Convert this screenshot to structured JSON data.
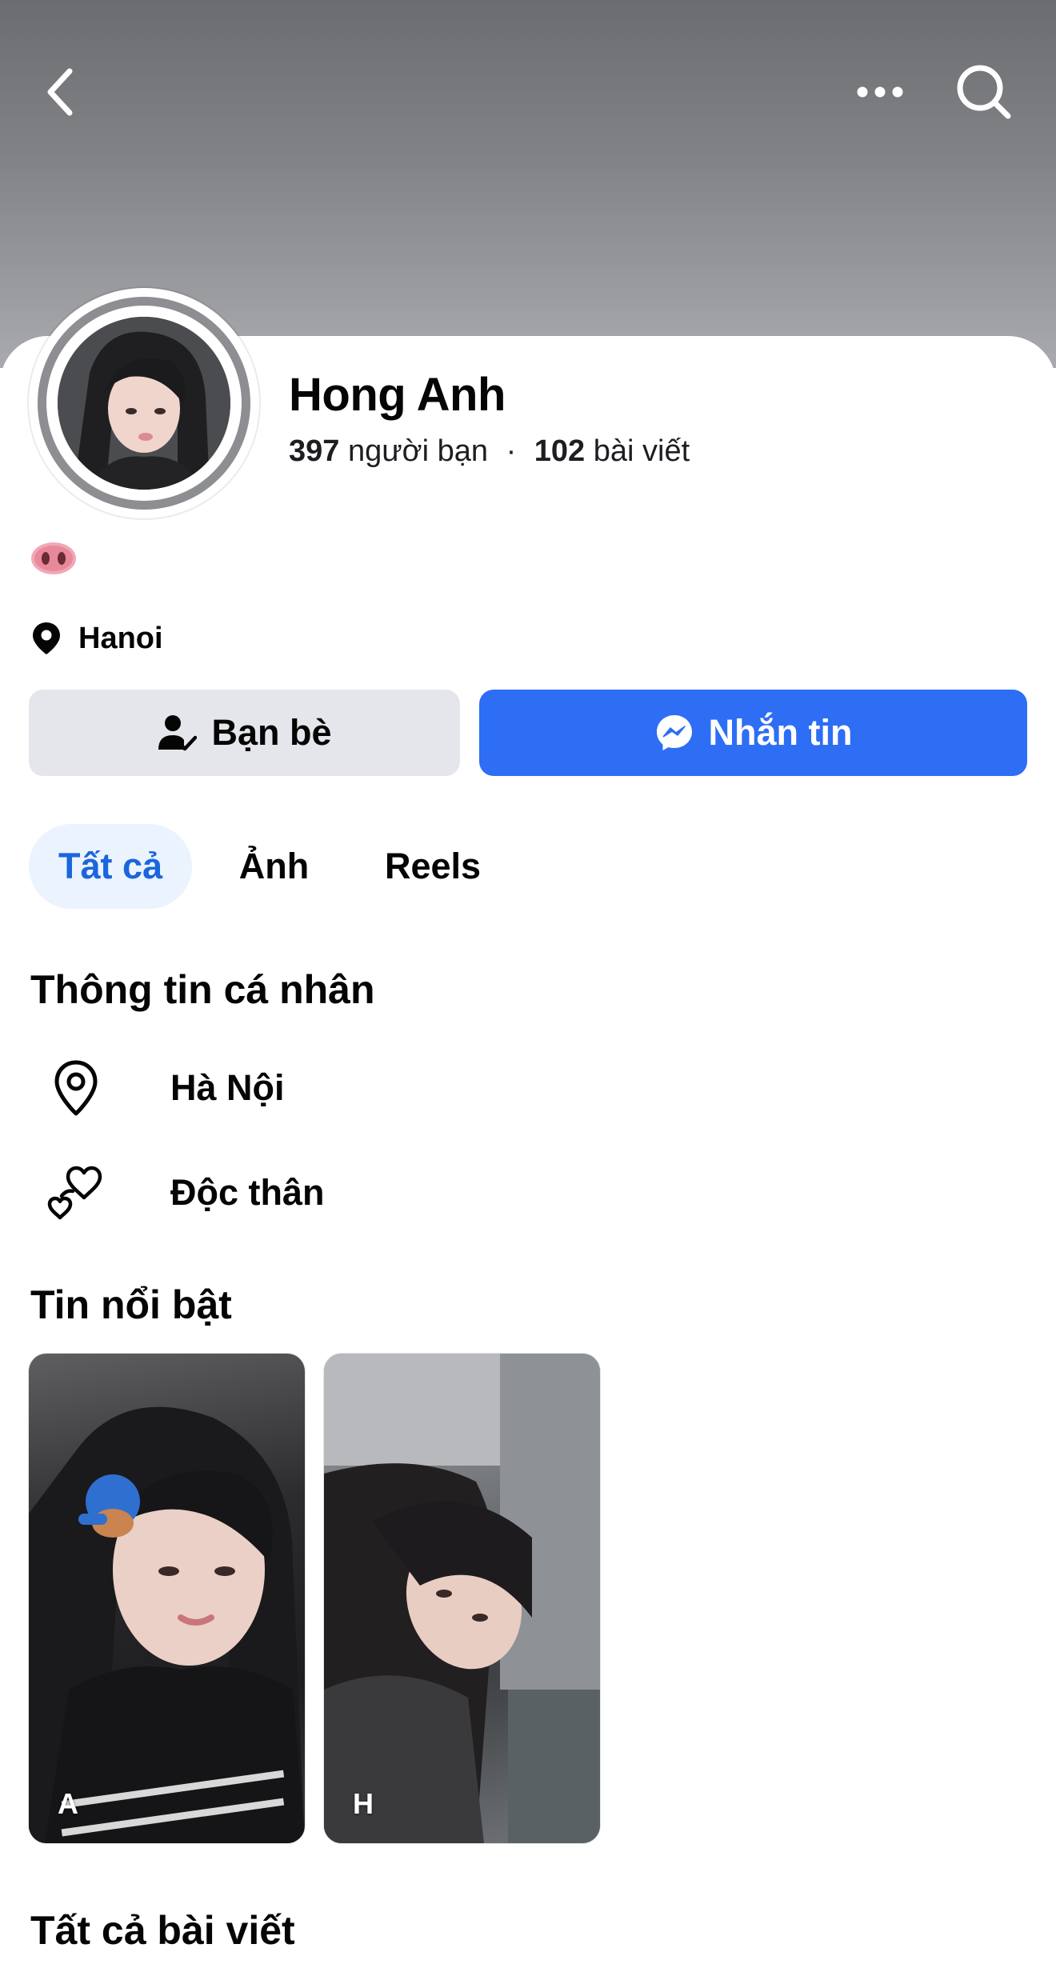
{
  "header": {
    "back_icon": "chevron-left-icon",
    "more_icon": "more-horizontal-icon",
    "search_icon": "search-icon"
  },
  "profile": {
    "name": "Hong Anh",
    "friends_count": "397",
    "friends_label": "người bạn",
    "separator": "·",
    "posts_count": "102",
    "posts_label": "bài viết",
    "bio_emoji": "pig-nose-emoji",
    "location": "Hanoi"
  },
  "actions": {
    "friends_label": "Bạn bè",
    "message_label": "Nhắn tin"
  },
  "tabs": [
    {
      "label": "Tất cả",
      "active": true
    },
    {
      "label": "Ảnh",
      "active": false
    },
    {
      "label": "Reels",
      "active": false
    }
  ],
  "personal_info": {
    "title": "Thông tin cá nhân",
    "items": [
      {
        "icon": "location-pin-icon",
        "text": "Hà Nội"
      },
      {
        "icon": "hearts-icon",
        "text": "Độc thân"
      }
    ]
  },
  "highlights": {
    "title": "Tin nổi bật",
    "items": [
      {
        "label": "A"
      },
      {
        "label": "H"
      }
    ]
  },
  "posts": {
    "title": "Tất cả bài viết"
  },
  "colors": {
    "accent_blue": "#2d6ef5",
    "tab_active_bg": "#ebf3ff",
    "tab_active_text": "#1b66dc",
    "button_gray": "#e4e6eb"
  }
}
